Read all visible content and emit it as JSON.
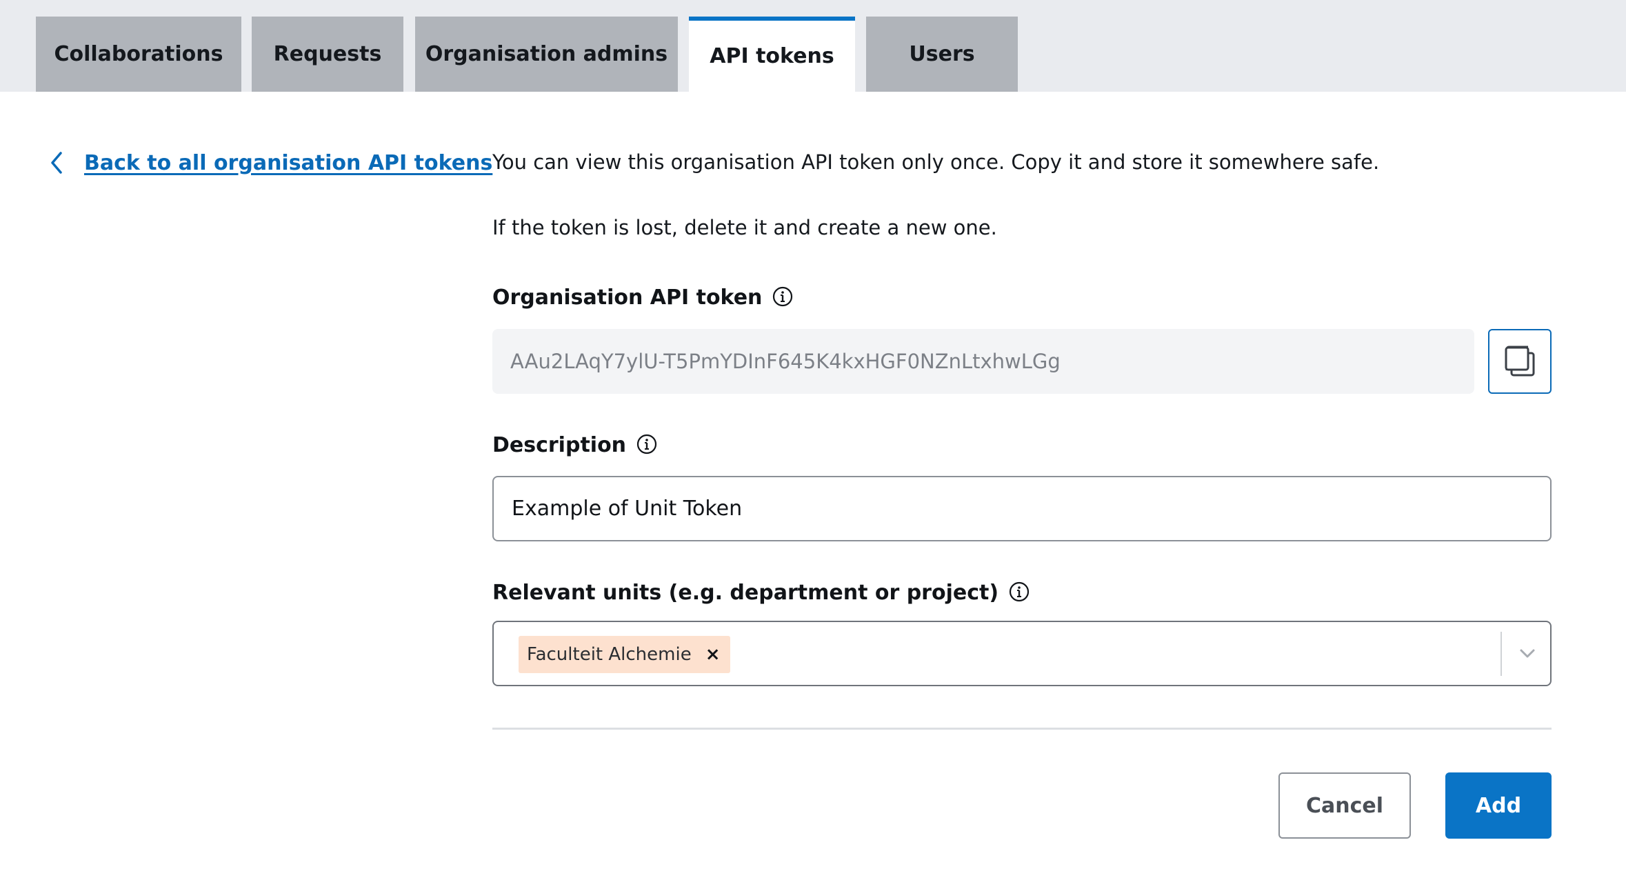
{
  "tabs": [
    {
      "label": "Collaborations",
      "active": false
    },
    {
      "label": "Requests",
      "active": false
    },
    {
      "label": "Organisation admins",
      "active": false
    },
    {
      "label": "API tokens",
      "active": true
    },
    {
      "label": "Users",
      "active": false
    }
  ],
  "back_link": {
    "label": "Back to all organisation API tokens",
    "icon": "chevron-left-icon"
  },
  "intro": {
    "line1": "You can view this organisation API token only once. Copy it and store it somewhere safe.",
    "line2": "If the token is lost, delete it and create a new one."
  },
  "token": {
    "label": "Organisation API token",
    "value": "AAu2LAqY7ylU-T5PmYDInF645K4kxHGF0NZnLtxhwLGg",
    "copy_icon": "copy-icon"
  },
  "description": {
    "label": "Description",
    "value": "Example of Unit Token"
  },
  "units": {
    "label": "Relevant units (e.g. department or project)",
    "selected": [
      "Faculteit Alchemie"
    ],
    "remove_glyph": "×"
  },
  "actions": {
    "cancel_label": "Cancel",
    "add_label": "Add"
  },
  "colors": {
    "accent": "#0a74c6",
    "link": "#0a6ab7",
    "tab_inactive": "#b0b4ba",
    "tabbar_bg": "#e9ebef",
    "chip_bg": "#fde1cf"
  }
}
